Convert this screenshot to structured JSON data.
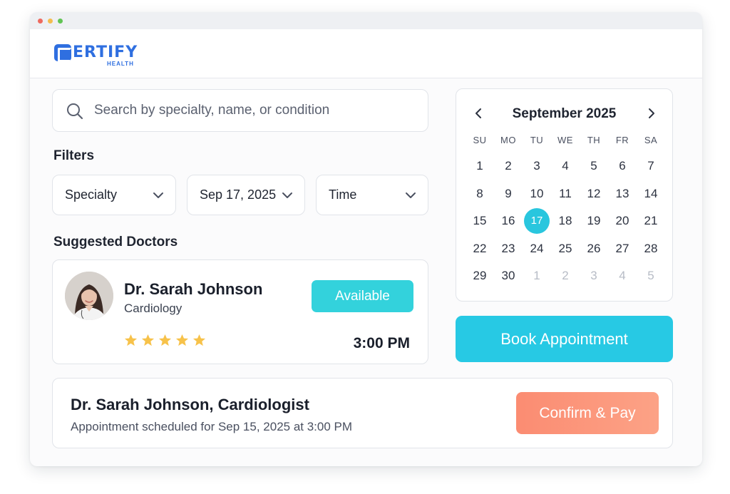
{
  "brand": {
    "name": "ERTIFY",
    "sub": "HEALTH",
    "color": "#2f6fe0"
  },
  "search": {
    "placeholder": "Search by specialty, name, or condition",
    "value": "",
    "icon": "search-icon"
  },
  "filters": {
    "heading": "Filters",
    "specialty": "Specialty",
    "date": "Sep 17, 2025",
    "time": "Time"
  },
  "suggested": {
    "heading": "Suggested Doctors",
    "doctor": {
      "name": "Dr. Sarah Johnson",
      "specialty": "Cardiology",
      "status": "Available",
      "rating": 5,
      "time": "3:00 PM"
    }
  },
  "calendar": {
    "month": "September 2025",
    "weekdays": [
      "SU",
      "MO",
      "TU",
      "WE",
      "TH",
      "FR",
      "SA"
    ],
    "weeks": [
      [
        "1",
        "2",
        "3",
        "4",
        "5",
        "6",
        "7"
      ],
      [
        "8",
        "9",
        "10",
        "11",
        "12",
        "13",
        "14"
      ],
      [
        "15",
        "16",
        "17",
        "18",
        "19",
        "20",
        "21"
      ],
      [
        "22",
        "23",
        "24",
        "25",
        "26",
        "27",
        "28"
      ],
      [
        "29",
        "30",
        "1",
        "2",
        "3",
        "4",
        "5"
      ]
    ],
    "selected": "17",
    "accent": "#29c6de"
  },
  "actions": {
    "book": "Book Appointment",
    "confirm": "Confirm & Pay"
  },
  "summary": {
    "title": "Dr. Sarah Johnson, Cardiologist",
    "detail": "Appointment scheduled for Sep 15, 2025 at 3:00 PM"
  }
}
